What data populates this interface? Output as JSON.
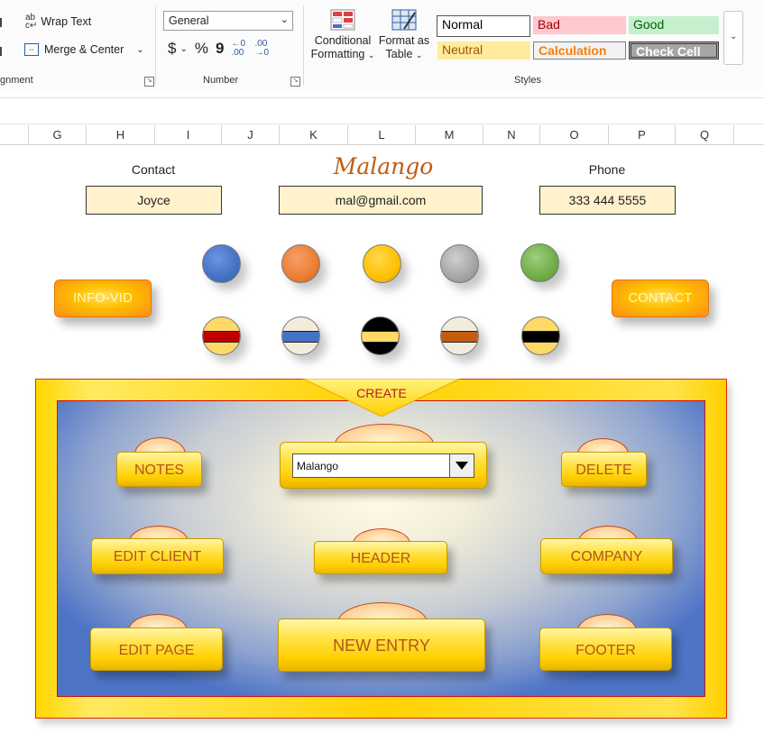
{
  "ribbon": {
    "alignment": {
      "wrap_text": "Wrap Text",
      "merge_center": "Merge & Center",
      "group_label": "gnment"
    },
    "number": {
      "format_value": "General",
      "currency": "$",
      "percent": "%",
      "comma": "9",
      "inc_decimal": "←0 .00",
      "dec_decimal": ".00 →0",
      "group_label": "Number"
    },
    "styles": {
      "conditional_formatting": [
        "Conditional",
        "Formatting"
      ],
      "format_as_table": [
        "Format as",
        "Table"
      ],
      "group_label": "Styles",
      "cells": [
        {
          "label": "Normal",
          "bg": "#ffffff",
          "fg": "#000000",
          "border": "#555555"
        },
        {
          "label": "Bad",
          "bg": "#ffc7ce",
          "fg": "#9c0006",
          "border": "#ffc7ce"
        },
        {
          "label": "Good",
          "bg": "#c6efce",
          "fg": "#006100",
          "border": "#c6efce"
        },
        {
          "label": "Neutral",
          "bg": "#ffeb9c",
          "fg": "#9c5700",
          "border": "#ffeb9c"
        },
        {
          "label": "Calculation",
          "bg": "#f2f2f2",
          "fg": "#fa7d00",
          "border": "#7f7f7f"
        },
        {
          "label": "Check Cell",
          "bg": "#a5a5a5",
          "fg": "#ffffff",
          "border": "#3f3f3f"
        }
      ]
    }
  },
  "columns": [
    "G",
    "H",
    "I",
    "J",
    "K",
    "L",
    "M",
    "N",
    "O",
    "P",
    "Q"
  ],
  "sheet": {
    "contact_label": "Contact",
    "contact_value": "Joyce",
    "logo_text": "Malango",
    "email_value": "mal@gmail.com",
    "phone_label": "Phone",
    "phone_value": "333 444 5555",
    "info_vid_button": "INFO-VID",
    "contact_button": "CONTACT",
    "color_swatches_top": [
      {
        "icon": "blue-dot-icon",
        "color": "#4472c4"
      },
      {
        "icon": "orange-dot-icon",
        "color": "#ed7d31"
      },
      {
        "icon": "gold-dot-icon",
        "color": "#ffc000"
      },
      {
        "icon": "gray-dot-icon",
        "color": "#a5a5a5"
      },
      {
        "icon": "green-dot-icon",
        "color": "#70ad47"
      }
    ],
    "color_swatches_bottom": [
      {
        "icon": "red-band-theme-icon",
        "outer": "#ffd966",
        "band": "#c00000"
      },
      {
        "icon": "blue-band-theme-icon",
        "outer": "#f2ecdd",
        "band": "#4472c4"
      },
      {
        "icon": "black-gold-theme-icon",
        "outer": "#000000",
        "band": "#ffd966"
      },
      {
        "icon": "orange-band-theme-icon",
        "outer": "#f2ecdd",
        "band": "#c55a11"
      },
      {
        "icon": "black-band-theme-icon",
        "outer": "#ffd966",
        "band": "#000000"
      }
    ]
  },
  "panel": {
    "create_label": "CREATE",
    "dropdown_value": "Malango",
    "buttons": {
      "notes": "NOTES",
      "delete": "DELETE",
      "edit_client": "EDIT CLIENT",
      "header": "HEADER",
      "company": "COMPANY",
      "edit_page": "EDIT PAGE",
      "new_entry": "NEW ENTRY",
      "footer": "FOOTER"
    }
  }
}
